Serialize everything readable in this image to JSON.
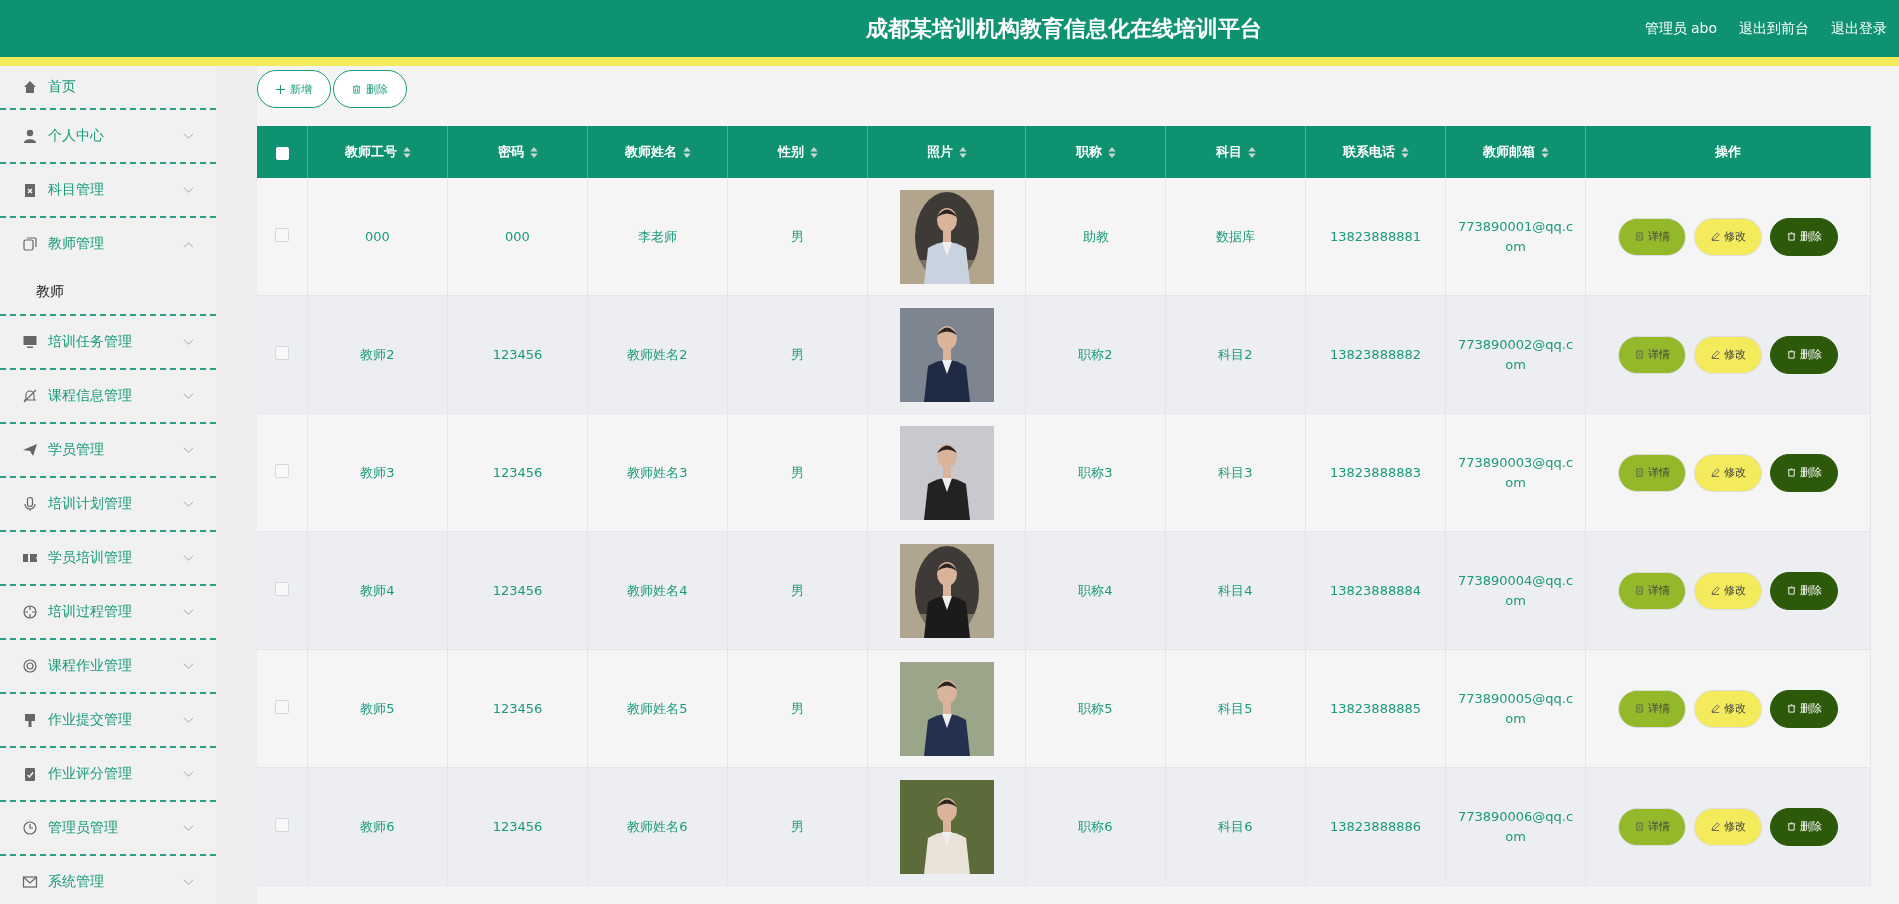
{
  "header": {
    "title": "成都某培训机构教育信息化在线培训平台",
    "user": "管理员 abo",
    "links": [
      "退出到前台",
      "退出登录"
    ]
  },
  "sidebar": {
    "items": [
      {
        "label": "首页",
        "has_arrow": false
      },
      {
        "label": "个人中心",
        "has_arrow": true,
        "expanded": false
      },
      {
        "label": "科目管理",
        "has_arrow": true,
        "expanded": false
      },
      {
        "label": "教师管理",
        "has_arrow": true,
        "expanded": true,
        "children": [
          {
            "label": "教师"
          }
        ]
      },
      {
        "label": "培训任务管理",
        "has_arrow": true,
        "expanded": false
      },
      {
        "label": "课程信息管理",
        "has_arrow": true,
        "expanded": false
      },
      {
        "label": "学员管理",
        "has_arrow": true,
        "expanded": false
      },
      {
        "label": "培训计划管理",
        "has_arrow": true,
        "expanded": false
      },
      {
        "label": "学员培训管理",
        "has_arrow": true,
        "expanded": false
      },
      {
        "label": "培训过程管理",
        "has_arrow": true,
        "expanded": false
      },
      {
        "label": "课程作业管理",
        "has_arrow": true,
        "expanded": false
      },
      {
        "label": "作业提交管理",
        "has_arrow": true,
        "expanded": false
      },
      {
        "label": "作业评分管理",
        "has_arrow": true,
        "expanded": false
      },
      {
        "label": "管理员管理",
        "has_arrow": true,
        "expanded": false
      },
      {
        "label": "系统管理",
        "has_arrow": true,
        "expanded": false
      }
    ]
  },
  "toolbar": [
    "新增",
    "删除"
  ],
  "table": {
    "select_all_checked": false,
    "columns": [
      {
        "label": "教师工号",
        "sortable": true
      },
      {
        "label": "密码",
        "sortable": true
      },
      {
        "label": "教师姓名",
        "sortable": true
      },
      {
        "label": "性别",
        "sortable": true
      },
      {
        "label": "照片",
        "sortable": true
      },
      {
        "label": "职称",
        "sortable": true
      },
      {
        "label": "科目",
        "sortable": true
      },
      {
        "label": "联系电话",
        "sortable": true
      },
      {
        "label": "教师邮箱",
        "sortable": true
      },
      {
        "label": "操作",
        "sortable": false
      }
    ],
    "rows": [
      {
        "checked": false,
        "id": "000",
        "password": "000",
        "name": "李老师",
        "gender": "男",
        "title": "助教",
        "subject": "数据库",
        "phone": "13823888881",
        "email": "773890001@qq.com",
        "actions": [
          "详情",
          "修改",
          "删除"
        ]
      },
      {
        "checked": false,
        "id": "教师2",
        "password": "123456",
        "name": "教师姓名2",
        "gender": "男",
        "title": "职称2",
        "subject": "科目2",
        "phone": "13823888882",
        "email": "773890002@qq.com",
        "actions": [
          "详情",
          "修改",
          "删除"
        ]
      },
      {
        "checked": false,
        "id": "教师3",
        "password": "123456",
        "name": "教师姓名3",
        "gender": "男",
        "title": "职称3",
        "subject": "科目3",
        "phone": "13823888883",
        "email": "773890003@qq.com",
        "actions": [
          "详情",
          "修改",
          "删除"
        ]
      },
      {
        "checked": false,
        "id": "教师4",
        "password": "123456",
        "name": "教师姓名4",
        "gender": "男",
        "title": "职称4",
        "subject": "科目4",
        "phone": "13823888884",
        "email": "773890004@qq.com",
        "actions": [
          "详情",
          "修改",
          "删除"
        ]
      },
      {
        "checked": false,
        "id": "教师5",
        "password": "123456",
        "name": "教师姓名5",
        "gender": "男",
        "title": "职称5",
        "subject": "科目5",
        "phone": "13823888885",
        "email": "773890005@qq.com",
        "actions": [
          "详情",
          "修改",
          "删除"
        ]
      },
      {
        "checked": false,
        "id": "教师6",
        "password": "123456",
        "name": "教师姓名6",
        "gender": "男",
        "title": "职称6",
        "subject": "科目6",
        "phone": "13823888886",
        "email": "773890006@qq.com",
        "actions": [
          "详情",
          "修改",
          "删除"
        ]
      }
    ]
  }
}
